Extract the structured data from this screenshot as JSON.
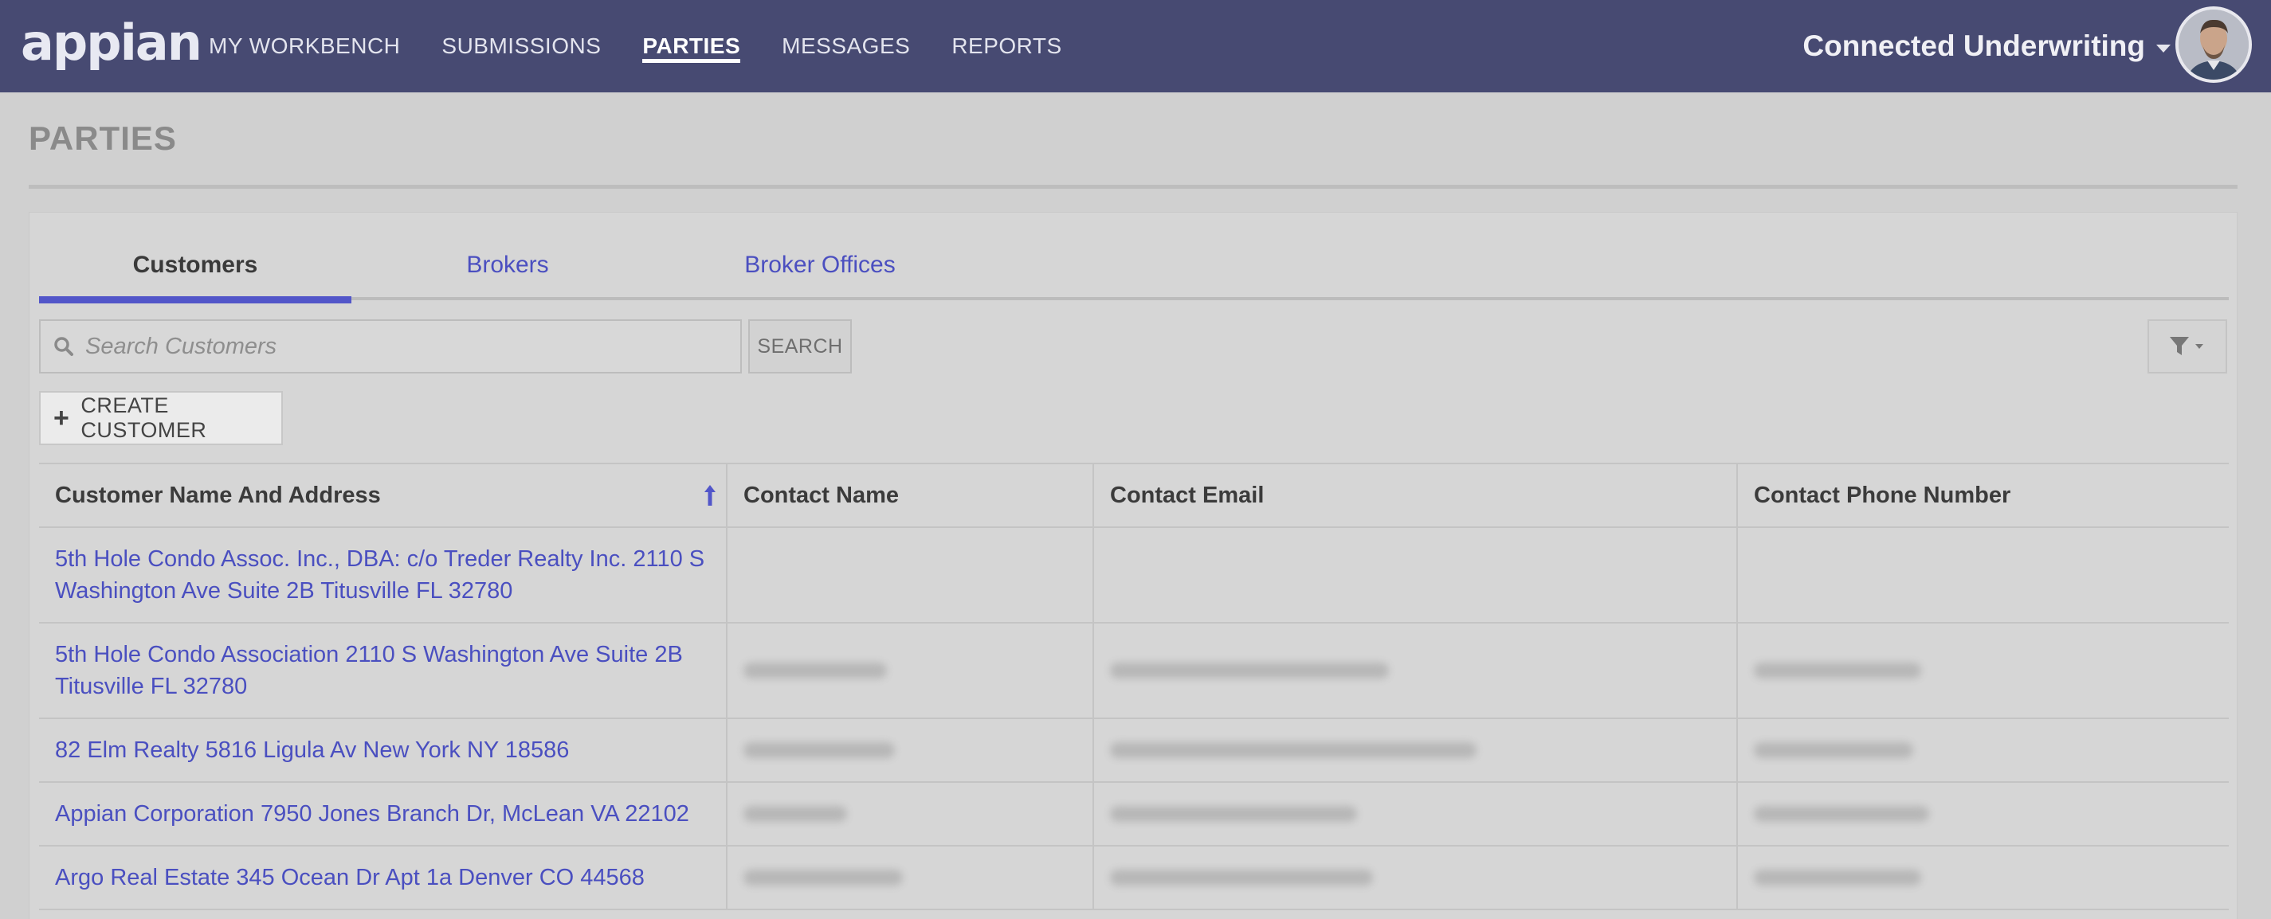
{
  "header": {
    "logo_text": "appian",
    "nav": [
      {
        "label": "MY WORKBENCH",
        "active": false
      },
      {
        "label": "SUBMISSIONS",
        "active": false
      },
      {
        "label": "PARTIES",
        "active": true
      },
      {
        "label": "MESSAGES",
        "active": false
      },
      {
        "label": "REPORTS",
        "active": false
      }
    ],
    "app_name": "Connected Underwriting",
    "avatar_icon": "user-avatar"
  },
  "page": {
    "title": "PARTIES"
  },
  "tabs": [
    {
      "label": "Customers",
      "active": true
    },
    {
      "label": "Brokers",
      "active": false
    },
    {
      "label": "Broker Offices",
      "active": false
    }
  ],
  "search": {
    "placeholder": "Search Customers",
    "value": "",
    "button_label": "SEARCH",
    "icon": "search-icon",
    "filter_icon": "filter-icon"
  },
  "create_button": {
    "label": "CREATE CUSTOMER",
    "icon": "plus-icon"
  },
  "table": {
    "columns": [
      "Customer Name And Address",
      "Contact Name",
      "Contact Email",
      "Contact Phone Number"
    ],
    "sort_icon": "sort-ascending-icon",
    "rows": [
      {
        "customer": "5th Hole Condo Assoc. Inc., DBA: c/o Treder Realty Inc. 2110 S Washington Ave Suite 2B Titusville FL 32780",
        "contact_blurred": false
      },
      {
        "customer": "5th Hole Condo Association 2110 S Washington Ave Suite 2B Titusville FL 32780",
        "contact_blurred": true
      },
      {
        "customer": "82 Elm Realty 5816 Ligula Av New York NY 18586",
        "contact_blurred": true
      },
      {
        "customer": "Appian Corporation 7950 Jones Branch Dr, McLean VA 22102",
        "contact_blurred": true
      },
      {
        "customer": "Argo Real Estate 345 Ocean Dr Apt 1a Denver CO 44568",
        "contact_blurred": true
      }
    ]
  },
  "colors": {
    "topbar": "#474a72",
    "accent": "#5256c9",
    "link": "#4a4fc0"
  }
}
